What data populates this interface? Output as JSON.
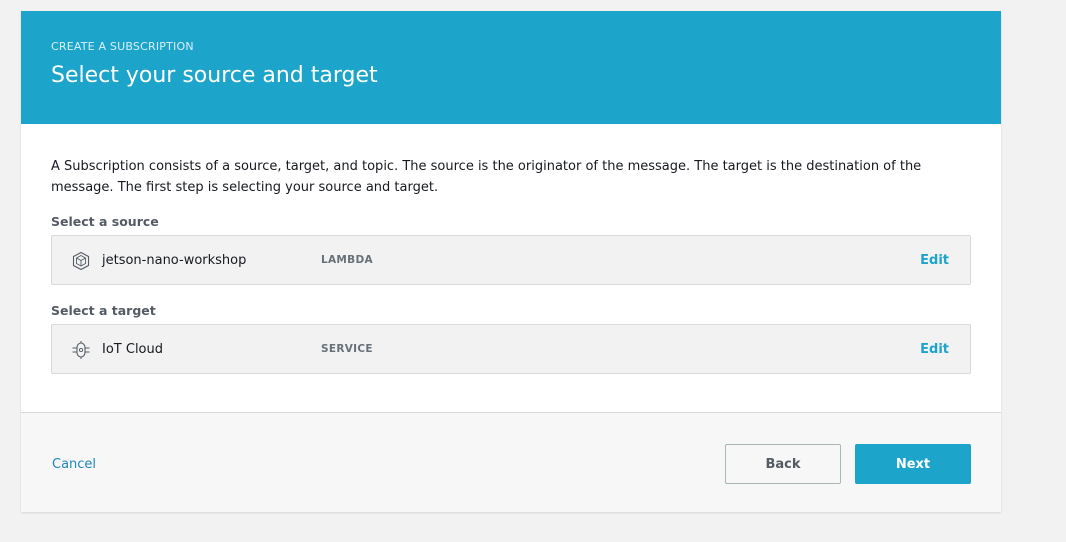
{
  "header": {
    "eyebrow": "CREATE A SUBSCRIPTION",
    "title": "Select your source and target"
  },
  "body": {
    "description": "A Subscription consists of a source, target, and topic. The source is the originator of the message. The target is the destination of the message. The first step is selecting your source and target.",
    "source": {
      "label": "Select a source",
      "name": "jetson-nano-workshop",
      "type": "LAMBDA",
      "icon": "lambda-cube-icon",
      "edit_label": "Edit"
    },
    "target": {
      "label": "Select a target",
      "name": "IoT Cloud",
      "type": "SERVICE",
      "icon": "iot-cloud-icon",
      "edit_label": "Edit"
    }
  },
  "footer": {
    "cancel_label": "Cancel",
    "back_label": "Back",
    "next_label": "Next"
  },
  "colors": {
    "accent": "#1ca4cb",
    "link": "#1c87b8",
    "background": "#f2f2f2"
  }
}
